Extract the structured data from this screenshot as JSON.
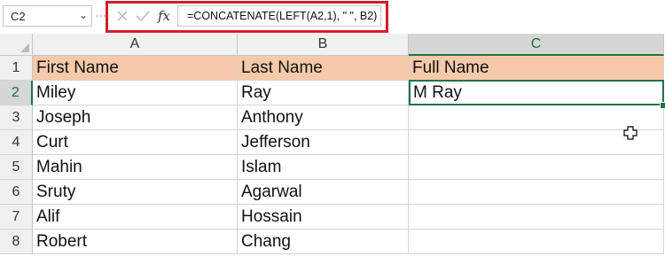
{
  "formula_bar": {
    "name_box": "C2",
    "name_box_arrow": "⌄",
    "cancel_icon": "close-icon",
    "enter_icon": "check-icon",
    "fx_label": "fx",
    "formula": "=CONCATENATE(LEFT(A2,1), \" \", B2)",
    "highlight_color": "#d0202a"
  },
  "grid": {
    "columns": [
      "A",
      "B",
      "C"
    ],
    "rows": [
      "1",
      "2",
      "3",
      "4",
      "5",
      "6",
      "7",
      "8"
    ],
    "active_cell": "C2",
    "header_fill": "#f7c9ab",
    "selection_color": "#217346",
    "data": [
      [
        "First Name",
        "Last Name",
        "Full Name"
      ],
      [
        "Miley",
        "Ray",
        "M Ray"
      ],
      [
        "Joseph",
        "Anthony",
        ""
      ],
      [
        "Curt",
        "Jefferson",
        ""
      ],
      [
        "Mahin",
        "Islam",
        ""
      ],
      [
        "Sruty",
        "Agarwal",
        ""
      ],
      [
        "Alif",
        "Hossain",
        ""
      ],
      [
        "Robert",
        "Chang",
        ""
      ]
    ]
  },
  "cursor": {
    "icon": "cell-select-cursor-icon"
  }
}
